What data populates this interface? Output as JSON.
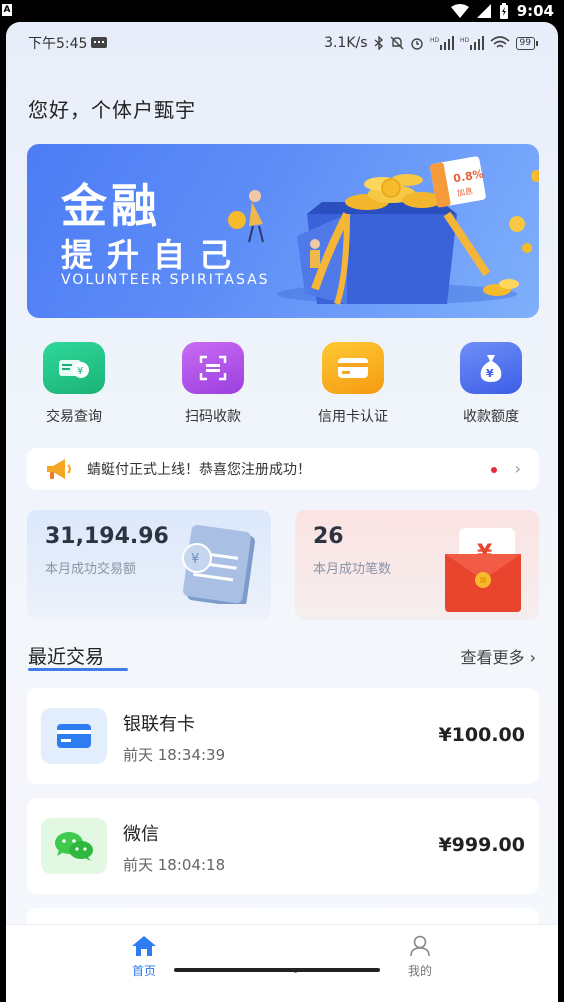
{
  "system_bar": {
    "time": "9:04",
    "badge": "A"
  },
  "status_line": {
    "time": "下午5:45",
    "speed": "3.1K/s",
    "battery": "99"
  },
  "greeting": "您好，个体户甄宇",
  "banner": {
    "title_line1": "金融",
    "title_line2": "提升自己",
    "subtitle": "VOLUNTEER SPIRITASAS",
    "tag": "0.8%",
    "tag_sub": "加息"
  },
  "quick_actions": [
    {
      "label": "交易查询",
      "icon": "money-icon",
      "color": "#25c487"
    },
    {
      "label": "扫码收款",
      "icon": "scan-icon",
      "color": "#b04ee8"
    },
    {
      "label": "信用卡认证",
      "icon": "card-icon",
      "color": "#f5a623"
    },
    {
      "label": "收款额度",
      "icon": "moneybag-icon",
      "color": "#5374ef"
    }
  ],
  "notice": {
    "text": "蜻蜓付正式上线！恭喜您注册成功！",
    "icon": "megaphone-icon"
  },
  "stats": [
    {
      "value": "31,194.96",
      "label": "本月成功交易额"
    },
    {
      "value": "26",
      "label": "本月成功笔数"
    }
  ],
  "recent": {
    "title": "最近交易",
    "more": "查看更多",
    "items": [
      {
        "name": "银联有卡",
        "time": "前天 18:34:39",
        "amount": "¥100.00",
        "icon": "card-icon"
      },
      {
        "name": "微信",
        "time": "前天 18:04:18",
        "amount": "¥999.00",
        "icon": "wechat-icon"
      }
    ]
  },
  "tabs": [
    {
      "label": "首页",
      "icon": "home-icon",
      "active": true
    },
    {
      "label": "我的",
      "icon": "user-icon",
      "active": false
    }
  ],
  "colors": {
    "accent": "#3d7de8",
    "banner": "#5f8ef7"
  }
}
